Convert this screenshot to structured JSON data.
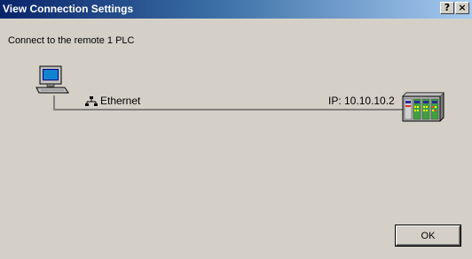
{
  "window": {
    "title": "View Connection Settings",
    "help_glyph": "?",
    "close_glyph": "×"
  },
  "info": {
    "text": "Connect to the remote 1 PLC"
  },
  "network": {
    "type_label": "Ethernet",
    "ip_label": "IP: 10.10.10.2",
    "icons": {
      "computer": "computer-icon",
      "network": "network-icon",
      "plc": "plc-icon"
    }
  },
  "buttons": {
    "ok_label": "OK"
  },
  "colors": {
    "titlebar_start": "#0a246a",
    "titlebar_end": "#a6caf0",
    "dialog_bg": "#d4d0c8",
    "connector_line": "#808080"
  }
}
